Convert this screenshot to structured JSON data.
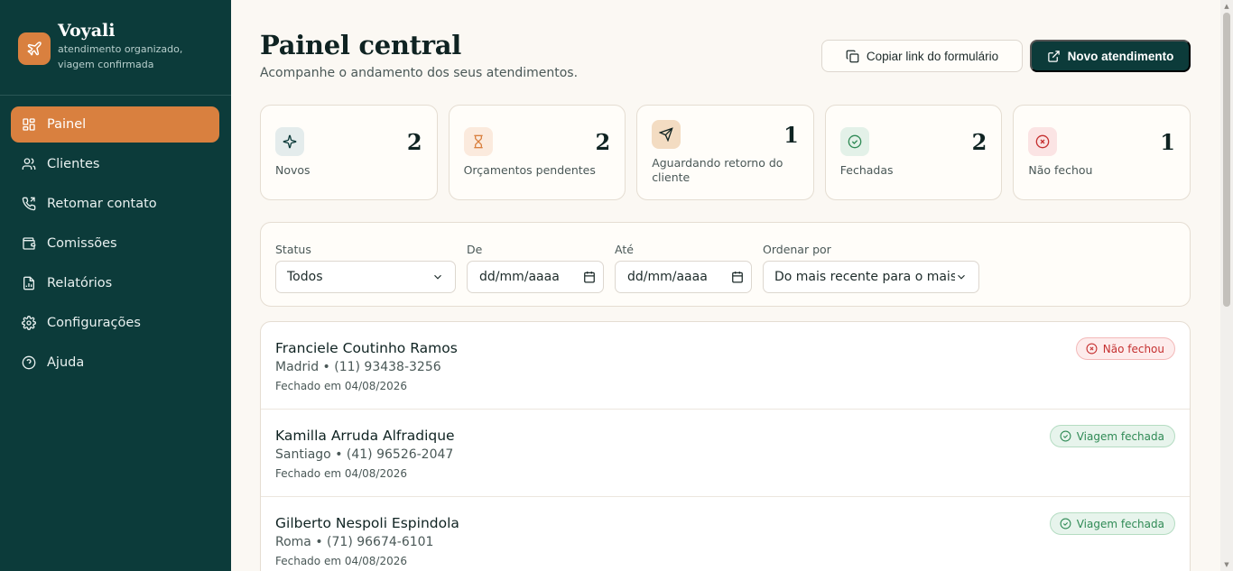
{
  "brand": {
    "name": "Voyali",
    "tagline": "atendimento organizado, viagem confirmada",
    "logo_icon": "plane-icon",
    "accent": "#d9803f"
  },
  "sidebar": {
    "items": [
      {
        "label": "Painel",
        "icon": "dashboard-icon",
        "active": true
      },
      {
        "label": "Clientes",
        "icon": "users-icon"
      },
      {
        "label": "Retomar contato",
        "icon": "phone-icon"
      },
      {
        "label": "Comissões",
        "icon": "wallet-icon"
      },
      {
        "label": "Relatórios",
        "icon": "report-icon"
      },
      {
        "label": "Configurações",
        "icon": "gear-icon"
      },
      {
        "label": "Ajuda",
        "icon": "help-icon"
      }
    ]
  },
  "header": {
    "title": "Painel central",
    "subtitle": "Acompanhe o andamento dos seus atendimentos.",
    "copy_button": "Copiar link do formulário",
    "new_button": "Novo atendimento"
  },
  "stats": [
    {
      "label": "Novos",
      "value": "2",
      "icon": "sparkles-icon"
    },
    {
      "label": "Orçamentos pendentes",
      "value": "2",
      "icon": "hourglass-icon"
    },
    {
      "label": "Aguardando retorno do cliente",
      "value": "1",
      "icon": "send-icon"
    },
    {
      "label": "Fechadas",
      "value": "2",
      "icon": "check-circle-icon"
    },
    {
      "label": "Não fechou",
      "value": "1",
      "icon": "x-circle-icon"
    }
  ],
  "filters": {
    "status_label": "Status",
    "status_value": "Todos",
    "from_label": "De",
    "from_value": "dd/mm/aaaa",
    "to_label": "Até",
    "to_value": "dd/mm/aaaa",
    "sort_label": "Ordenar por",
    "sort_value": "Do mais recente para o mais antigo"
  },
  "records": [
    {
      "name": "Franciele Coutinho Ramos",
      "destination": "Madrid",
      "phone": "(11) 93438-3256",
      "meta": "Madrid • (11) 93438-3256",
      "date": "Fechado em 04/08/2026",
      "status": "Não fechou",
      "status_color": "#c53030"
    },
    {
      "name": "Kamilla Arruda Alfradique",
      "destination": "Santiago",
      "phone": "(41) 96526-2047",
      "meta": "Santiago • (41) 96526-2047",
      "date": "Fechado em 04/08/2026",
      "status": "Viagem fechada",
      "status_color": "#2f8a55"
    },
    {
      "name": "Gilberto Nespoli Espindola",
      "destination": "Roma",
      "phone": "(71) 96674-6101",
      "meta": "Roma • (71) 96674-6101",
      "date": "Fechado em 04/08/2026",
      "status": "Viagem fechada",
      "status_color": "#2f8a55"
    }
  ],
  "colors": {
    "sidebar_bg": "#0c3b3a",
    "page_bg": "#fbf8f3",
    "primary": "#0c3b3a"
  }
}
